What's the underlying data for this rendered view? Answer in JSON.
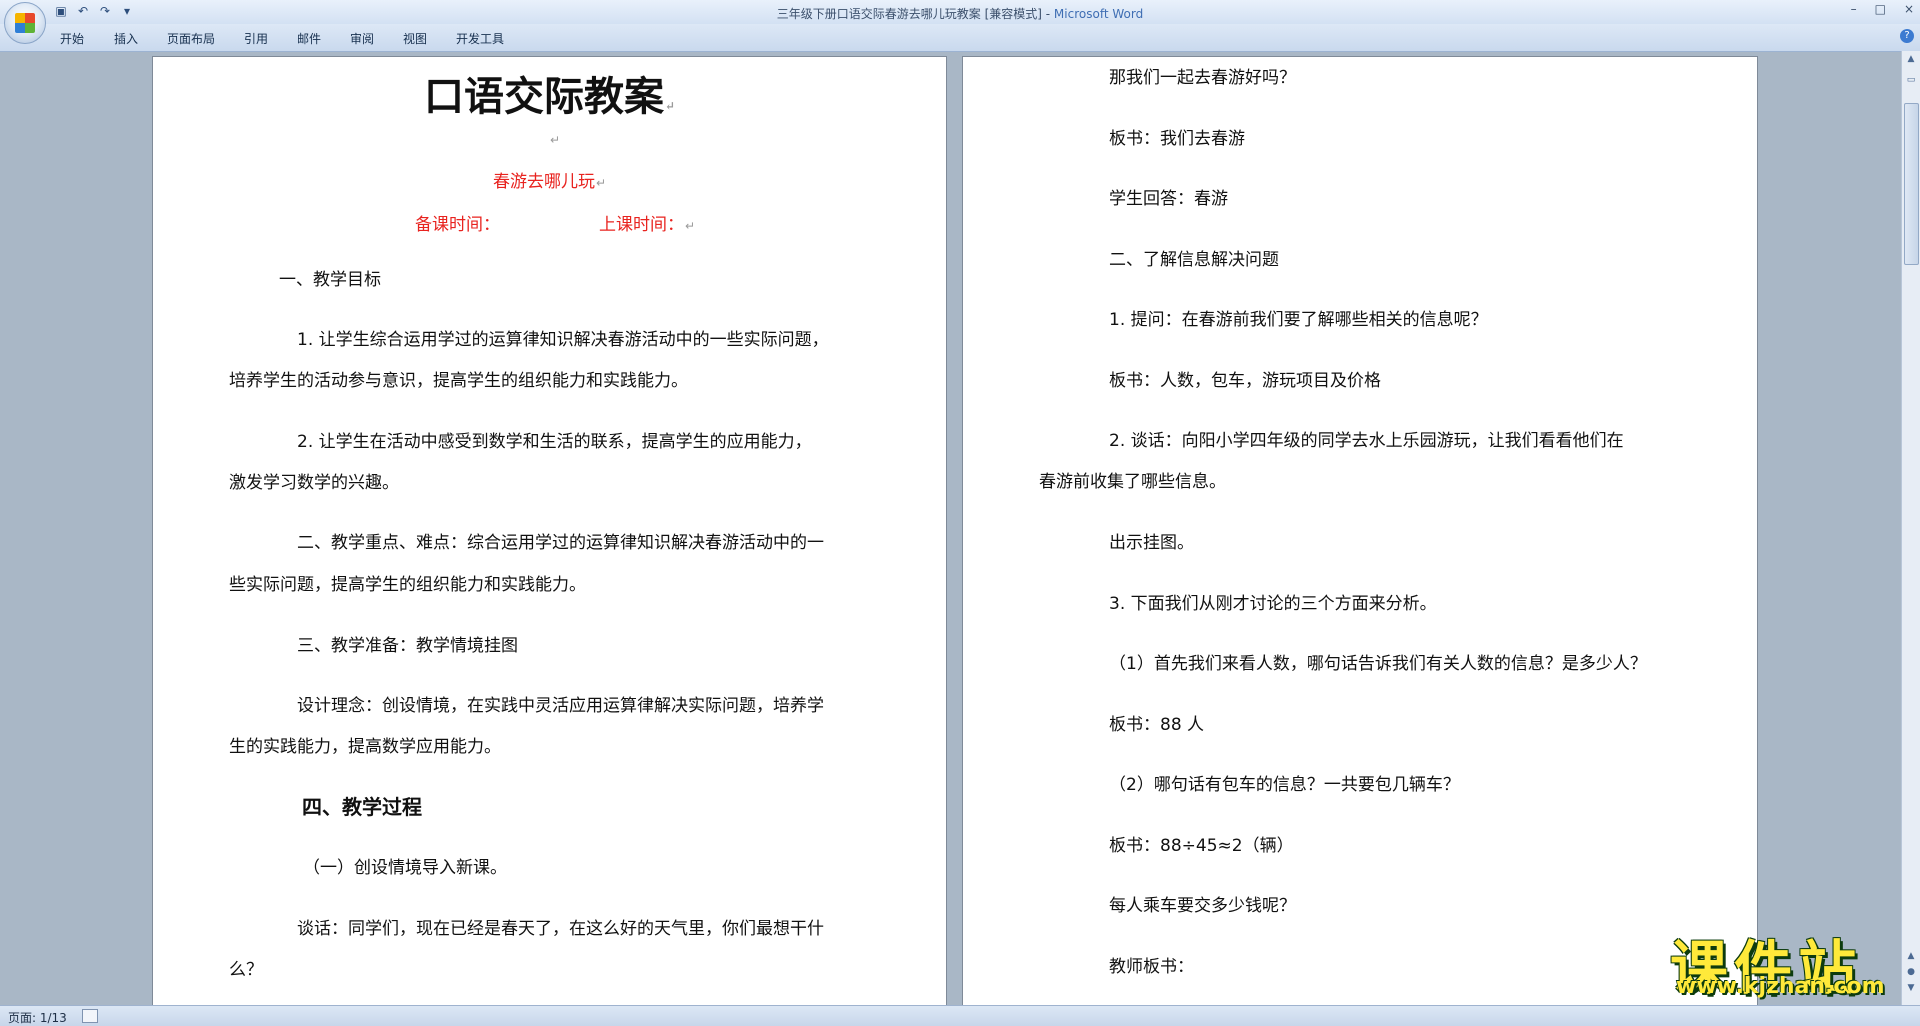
{
  "window": {
    "title": "三年级下册口语交际春游去哪儿玩教案 [兼容模式] - ",
    "app_name": "Microsoft Word",
    "controls": [
      "–",
      "□",
      "×"
    ]
  },
  "quick_access": {
    "save_icon": "save-icon",
    "undo_icon": "undo-icon",
    "redo_icon": "redo-icon",
    "customize_icon": "dropdown-icon"
  },
  "ribbon": {
    "tabs": [
      "开始",
      "插入",
      "页面布局",
      "引用",
      "邮件",
      "审阅",
      "视图",
      "开发工具"
    ],
    "help": "?"
  },
  "page1": {
    "title": "口语交际教案",
    "subtitle": "春游去哪儿玩",
    "prep_time": "备课时间：",
    "class_time": "上课时间：",
    "lines": [
      "一、教学目标",
      "1. 让学生综合运用学过的运算律知识解决春游活动中的一些实际问题，",
      "培养学生的活动参与意识，提高学生的组织能力和实践能力。",
      "2. 让学生在活动中感受到数学和生活的联系，提高学生的应用能力，",
      "激发学习数学的兴趣。",
      "二、教学重点、难点：综合运用学过的运算律知识解决春游活动中的一",
      "些实际问题，提高学生的组织能力和实践能力。",
      "三、教学准备：教学情境挂图",
      "设计理念：创设情境，在实践中灵活应用运算律解决实际问题，培养学",
      "生的实践能力，提高数学应用能力。",
      "四、教学过程",
      "（一）创设情境导入新课。",
      "谈话：同学们，现在已经是春天了，在这么好的天气里，你们最想干什",
      "么？"
    ],
    "paragraph_mark": "↵"
  },
  "page2": {
    "lines": [
      "那我们一起去春游好吗？",
      "板书：我们去春游",
      "学生回答：春游",
      "二、了解信息解决问题",
      "1. 提问：在春游前我们要了解哪些相关的信息呢？",
      "板书：人数，包车，游玩项目及价格",
      "2. 谈话：向阳小学四年级的同学去水上乐园游玩，让我们看看他们在",
      "春游前收集了哪些信息。",
      "出示挂图。",
      "3. 下面我们从刚才讨论的三个方面来分析。",
      "（1）首先我们来看人数，哪句话告诉我们有关人数的信息？是多少人？",
      "板书：88 人",
      "（2）哪句话有包车的信息？一共要包几辆车？",
      "板书：88÷45≈2（辆）",
      "每人乘车要交多少钱呢？",
      "教师板书："
    ]
  },
  "statusbar": {
    "page_indicator": "页面: 1/13"
  },
  "watermark": {
    "site_name": "课件站",
    "url": "www.kjzhan.com"
  },
  "colors": {
    "accent_red": "#e8231f",
    "workspace": "#a9b7c6",
    "ribbon": "#d3e1f3"
  }
}
